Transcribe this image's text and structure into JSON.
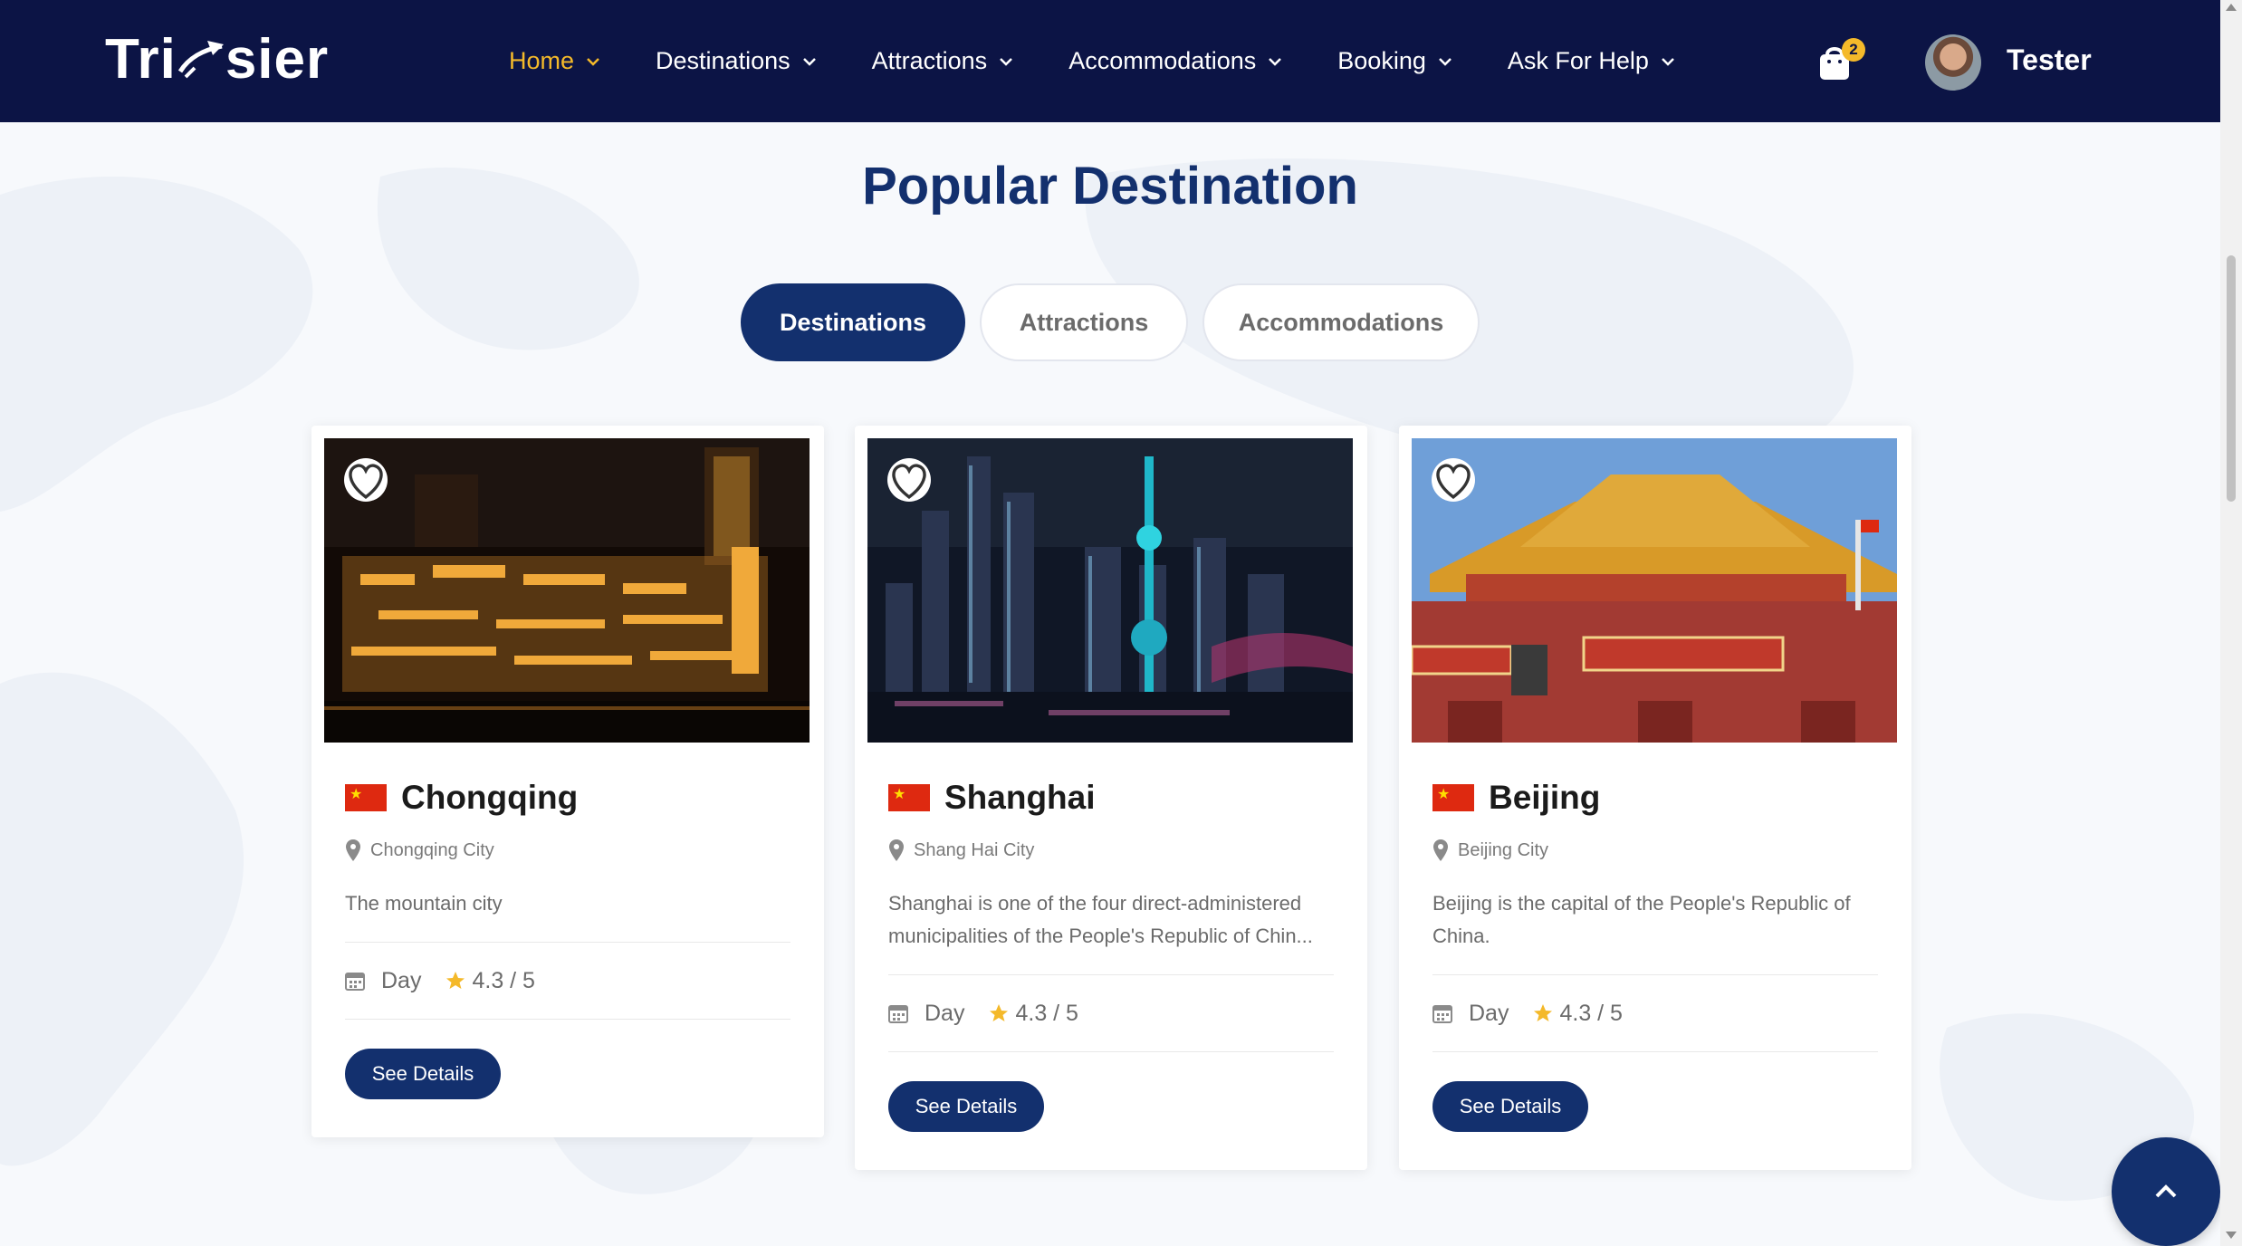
{
  "app": {
    "brand": "Tripsier",
    "brand_parts": [
      "Tri",
      "sier"
    ]
  },
  "nav": {
    "items": [
      {
        "label": "Home",
        "active": true
      },
      {
        "label": "Destinations",
        "active": false
      },
      {
        "label": "Attractions",
        "active": false
      },
      {
        "label": "Accommodations",
        "active": false
      },
      {
        "label": "Booking",
        "active": false
      },
      {
        "label": "Ask For Help",
        "active": false
      }
    ],
    "cart_count": "2",
    "user_name": "Tester"
  },
  "section": {
    "title": "Popular Destination",
    "tabs": [
      {
        "label": "Destinations",
        "active": true
      },
      {
        "label": "Attractions",
        "active": false
      },
      {
        "label": "Accommodations",
        "active": false
      }
    ]
  },
  "cards": [
    {
      "title": "Chongqing",
      "location": "Chongqing City",
      "description": "The mountain city",
      "duration": "Day",
      "rating": "4.3 / 5",
      "button": "See Details"
    },
    {
      "title": "Shanghai",
      "location": "Shang Hai City",
      "description": "Shanghai is one of the four direct-administered municipalities of the People's Republic of Chin...",
      "duration": "Day",
      "rating": "4.3 / 5",
      "button": "See Details"
    },
    {
      "title": "Beijing",
      "location": "Beijing City",
      "description": "Beijing is the capital of the People's Republic of China.",
      "duration": "Day",
      "rating": "4.3 / 5",
      "button": "See Details"
    }
  ],
  "colors": {
    "header_bg": "#0c1445",
    "accent": "#f4b92a",
    "primary": "#13306e",
    "flag_red": "#de2910"
  },
  "icons": [
    "chevron-down-icon",
    "cart-icon",
    "heart-icon",
    "map-pin-icon",
    "calendar-icon",
    "star-icon",
    "chevron-up-icon"
  ]
}
